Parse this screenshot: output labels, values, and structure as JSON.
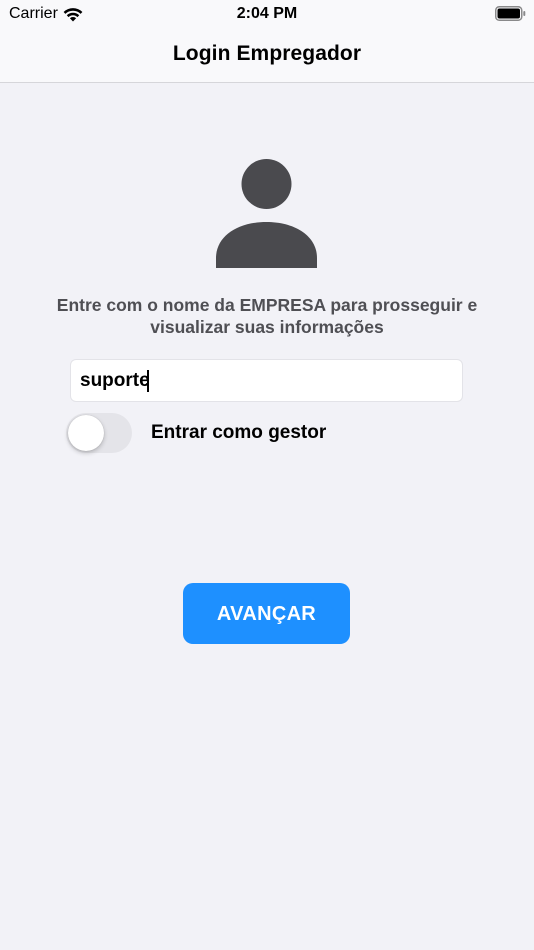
{
  "status_bar": {
    "carrier": "Carrier",
    "time": "2:04 PM",
    "wifi_icon": "wifi-icon",
    "battery_icon": "battery-icon"
  },
  "nav": {
    "title": "Login Empregador"
  },
  "avatar": {
    "icon": "person-icon",
    "color": "#4a4a4e"
  },
  "prompt": {
    "text": "Entre com o nome da EMPRESA para prosseguir e visualizar suas informações"
  },
  "company_field": {
    "value": "suporte"
  },
  "manager_toggle": {
    "label": "Entrar como gestor",
    "on": false
  },
  "advance_button": {
    "label": "AVANÇAR",
    "color": "#1e90ff"
  }
}
